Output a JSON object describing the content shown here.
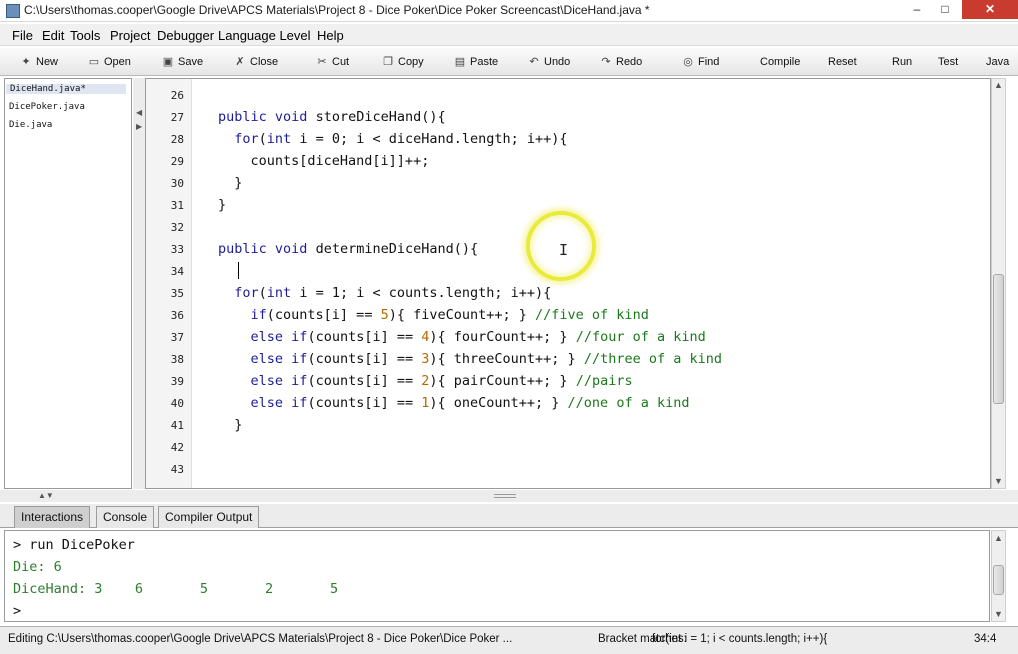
{
  "window": {
    "title": "C:\\Users\\thomas.cooper\\Google Drive\\APCS Materials\\Project 8 - Dice Poker\\Dice Poker Screencast\\DiceHand.java *",
    "min_label": "–",
    "max_label": "□",
    "close_label": "✕"
  },
  "menu": [
    "File",
    "Edit",
    "Tools",
    "Project",
    "Debugger",
    "Language Level",
    "Help"
  ],
  "toolbar": [
    {
      "label": "New",
      "icon": "new-file-icon",
      "glyph": "✦"
    },
    {
      "label": "Open",
      "icon": "open-folder-icon",
      "glyph": "▭"
    },
    {
      "label": "Save",
      "icon": "save-disk-icon",
      "glyph": "▣"
    },
    {
      "label": "Close",
      "icon": "close-file-icon",
      "glyph": "✗"
    },
    {
      "label": "Cut",
      "icon": "scissors-icon",
      "glyph": "✂"
    },
    {
      "label": "Copy",
      "icon": "copy-icon",
      "glyph": "❐"
    },
    {
      "label": "Paste",
      "icon": "paste-clipboard-icon",
      "glyph": "▤"
    },
    {
      "label": "Undo",
      "icon": "undo-icon",
      "glyph": "↶"
    },
    {
      "label": "Redo",
      "icon": "redo-icon",
      "glyph": "↷"
    },
    {
      "label": "Find",
      "icon": "binoculars-icon",
      "glyph": "◎"
    },
    {
      "label": "Compile",
      "icon": "",
      "glyph": ""
    },
    {
      "label": "Reset",
      "icon": "",
      "glyph": ""
    },
    {
      "label": "Run",
      "icon": "",
      "glyph": ""
    },
    {
      "label": "Test",
      "icon": "",
      "glyph": ""
    },
    {
      "label": "Java",
      "icon": "",
      "glyph": ""
    }
  ],
  "files": [
    "DiceHand.java*",
    "DicePoker.java",
    "Die.java"
  ],
  "editor": {
    "lines": [
      {
        "n": "26",
        "code": ""
      },
      {
        "n": "27",
        "code": "public void storeDiceHand(){"
      },
      {
        "n": "28",
        "code": "  for(int i = 0; i < diceHand.length; i++){"
      },
      {
        "n": "29",
        "code": "    counts[diceHand[i]]++;"
      },
      {
        "n": "30",
        "code": "  }"
      },
      {
        "n": "31",
        "code": "}"
      },
      {
        "n": "32",
        "code": ""
      },
      {
        "n": "33",
        "code": "public void determineDiceHand(){"
      },
      {
        "n": "34",
        "code": ""
      },
      {
        "n": "35",
        "code": "  for(int i = 1; i < counts.length; i++){"
      },
      {
        "n": "36",
        "code": "    if(counts[i] == 5){ fiveCount++; } //five of kind"
      },
      {
        "n": "37",
        "code": "    else if(counts[i] == 4){ fourCount++; } //four of a kind"
      },
      {
        "n": "38",
        "code": "    else if(counts[i] == 3){ threeCount++; } //three of a kind"
      },
      {
        "n": "39",
        "code": "    else if(counts[i] == 2){ pairCount++; } //pairs"
      },
      {
        "n": "40",
        "code": "    else if(counts[i] == 1){ oneCount++; } //one of a kind"
      },
      {
        "n": "41",
        "code": "  }"
      },
      {
        "n": "42",
        "code": ""
      },
      {
        "n": "43",
        "code": ""
      }
    ]
  },
  "tabs": [
    "Interactions",
    "Console",
    "Compiler Output"
  ],
  "interactions": [
    {
      "kind": "prompt",
      "text": "> run DicePoker"
    },
    {
      "kind": "out",
      "text": "Die: 6"
    },
    {
      "kind": "out",
      "text": "DiceHand: 3    6       5       2       5"
    },
    {
      "kind": "prompt",
      "text": ">"
    }
  ],
  "status": {
    "text": "Editing C:\\Users\\thomas.cooper\\Google Drive\\APCS Materials\\Project 8 - Dice Poker\\Dice Poker ...",
    "match_label": "Bracket matches:",
    "match_code": "for(int i = 1; i < counts.length; i++){",
    "position": "34:4"
  },
  "colors": {
    "keyword": "#1d1d9a",
    "comment": "#1a7a1a",
    "number": "#b36b00",
    "output": "#2f7d2f",
    "cursor_highlight": "#eaea3a"
  }
}
